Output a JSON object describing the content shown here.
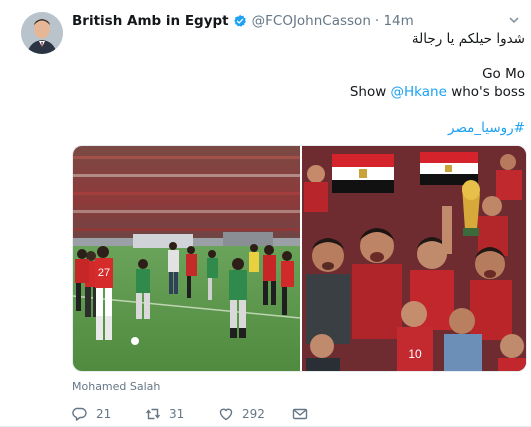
{
  "tweet": {
    "author_name": "British Amb in Egypt",
    "author_handle": "@FCOJohnCasson",
    "time": "· 14m",
    "line1": "شدوا حيلكم يا رجالة",
    "line2": "Go Mo",
    "line3_prefix": "Show ",
    "line3_mention": "@Hkane",
    "line3_suffix": " who's boss",
    "hashtag": "#روسيا_مصر",
    "media_tag": "Mohamed Salah",
    "replies": "21",
    "retweets": "31",
    "likes": "292"
  },
  "colors": {
    "link": "#1da1f2",
    "muted": "#657786",
    "verified": "#1da1f2"
  },
  "icons": [
    "avatar",
    "verified-badge-icon",
    "caret-down-icon",
    "reply-icon",
    "retweet-icon",
    "like-icon",
    "direct-message-icon"
  ]
}
